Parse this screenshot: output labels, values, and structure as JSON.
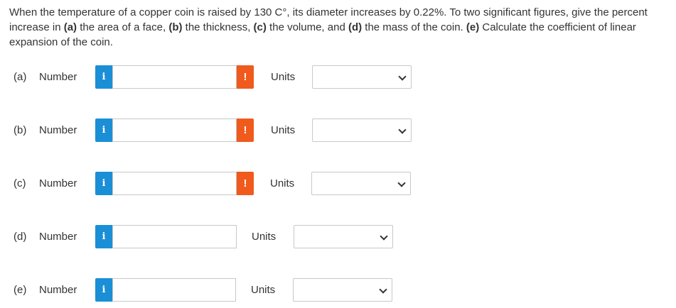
{
  "question": {
    "seg1": "When the temperature of a copper coin is raised by 130 C°, its diameter increases by 0.22%. To two significant figures, give the percent increase in ",
    "a": "(a)",
    "seg2": " the area of a face, ",
    "b": "(b)",
    "seg3": " the thickness, ",
    "c": "(c)",
    "seg4": " the volume, and ",
    "d": "(d)",
    "seg5": " the mass of the coin. ",
    "e": "(e)",
    "seg6": " Calculate the coefficient of linear expansion of the coin."
  },
  "rows": [
    {
      "part": "(a)",
      "number_label": "Number",
      "info": "i",
      "value": "",
      "alert": "!",
      "units_label": "Units",
      "units_value": ""
    },
    {
      "part": "(b)",
      "number_label": "Number",
      "info": "i",
      "value": "",
      "alert": "!",
      "units_label": "Units",
      "units_value": ""
    },
    {
      "part": "(c)",
      "number_label": "Number",
      "info": "i",
      "value": "",
      "alert": "!",
      "units_label": "Units",
      "units_value": ""
    },
    {
      "part": "(d)",
      "number_label": "Number",
      "info": "i",
      "value": "",
      "units_label": "Units",
      "units_value": ""
    },
    {
      "part": "(e)",
      "number_label": "Number",
      "info": "i",
      "value": "",
      "units_label": "Units",
      "units_value": ""
    }
  ],
  "colors": {
    "info_blue": "#1a8fd6",
    "alert_orange": "#f05a1c",
    "border_gray": "#c8c8c8",
    "text": "#333333"
  }
}
